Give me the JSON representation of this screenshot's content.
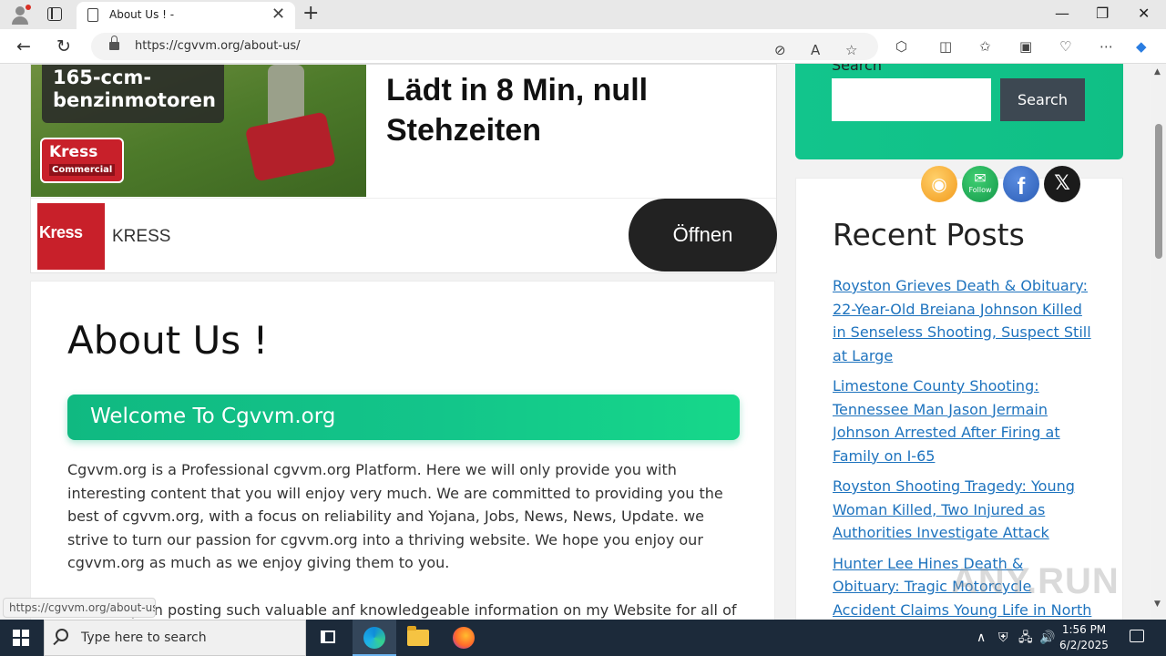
{
  "browser": {
    "tab_title": "About Us ! -",
    "tab_close": "✕",
    "new_tab": "+",
    "url": "https://cgvvm.org/about-us/",
    "window_controls": {
      "minimize": "—",
      "maximize": "❐",
      "close": "✕"
    },
    "nav": {
      "back": "←",
      "reload": "↻"
    },
    "toolbar_icons": [
      "tracking-blocked-icon",
      "read-aloud-icon",
      "favorite-star-icon",
      "extensions-icon",
      "split-screen-icon",
      "favorites-icon",
      "collections-icon",
      "browser-essentials-icon",
      "more-menu-icon",
      "copilot-icon"
    ]
  },
  "ad": {
    "image_overlay_text": "165-ccm-benzinmotoren",
    "logo_name": "Kress",
    "logo_sub": "Commercial",
    "headline": "Lädt in 8 Min, null Stehzeiten",
    "brand_logo": "Kress",
    "brand_name": "KRESS",
    "cta_label": "Öffnen"
  },
  "article": {
    "title": "About Us !",
    "welcome_banner": "Welcome To Cgvvm.org",
    "paragraph_1": "Cgvvm.org is a Professional cgvvm.org Platform. Here we will only provide you with interesting content that you will enjoy very much. We are committed to providing you the best of cgvvm.org, with a focus on reliability and Yojana, Jobs, News, News, Update. we strive to turn our passion for cgvvm.org into a thriving website. We hope you enjoy our cgvvm.org as much as we enjoy giving them to you.",
    "paragraph_2": "I will keep on posting such valuable anf knowledgeable information on my Website for all of you."
  },
  "status_bar_link": "https://cgvvm.org/about-us/",
  "sidebar": {
    "search_label": "Search",
    "search_placeholder": "",
    "search_button": "Search",
    "social": {
      "rss_glyph": "◉",
      "follow_glyph": "✉",
      "follow_label": "Follow",
      "facebook_glyph": "f",
      "x_glyph": "𝕏"
    },
    "recent_posts_heading": "Recent Posts",
    "recent_posts": [
      "Royston Grieves Death & Obituary: 22-Year-Old Breiana Johnson Killed in Senseless Shooting, Suspect Still at Large",
      "Limestone County Shooting: Tennessee Man Jason Jermain Johnson Arrested After Firing at Family on I-65",
      "Royston Shooting Tragedy: Young Woman Killed, Two Injured as Authorities Investigate Attack",
      "Hunter Lee Hines Death & Obituary: Tragic Motorcycle Accident Claims Young Life in North Carolina"
    ],
    "watermark": "ANY.RUN"
  },
  "taskbar": {
    "search_placeholder": "Type here to search",
    "time": "1:56 PM",
    "date": "6/2/2025",
    "tray": {
      "chevron": "∧",
      "network": "🖧",
      "volume": "🔊"
    }
  },
  "colors": {
    "accent_green": "#10b981",
    "link_blue": "#1e73be",
    "search_button": "#3d4852",
    "kress_red": "#c8202a",
    "taskbar": "#1c2a3a"
  }
}
